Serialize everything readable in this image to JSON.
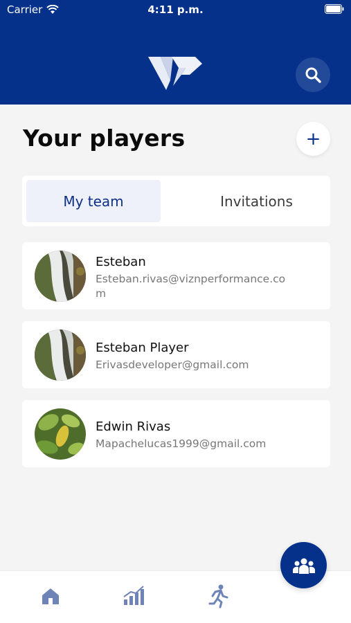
{
  "status_bar": {
    "carrier": "Carrier",
    "time": "4:11 p.m."
  },
  "header": {
    "logo_icon": "vp-logo-icon",
    "search_icon": "search-icon"
  },
  "page": {
    "title": "Your players",
    "add_icon": "+"
  },
  "tabs": {
    "my_team": "My team",
    "invitations": "Invitations"
  },
  "players": [
    {
      "name": "Esteban",
      "email": "Esteban.rivas@viznperformance.co",
      "email_wrap": "m"
    },
    {
      "name": "Esteban Player",
      "email": "Erivasdeveloper@gmail.com"
    },
    {
      "name": "Edwin Rivas",
      "email": "Mapachelucas1999@gmail.com"
    }
  ],
  "colors": {
    "brand": "#05318a",
    "nav_icon": "#6e84b6"
  }
}
